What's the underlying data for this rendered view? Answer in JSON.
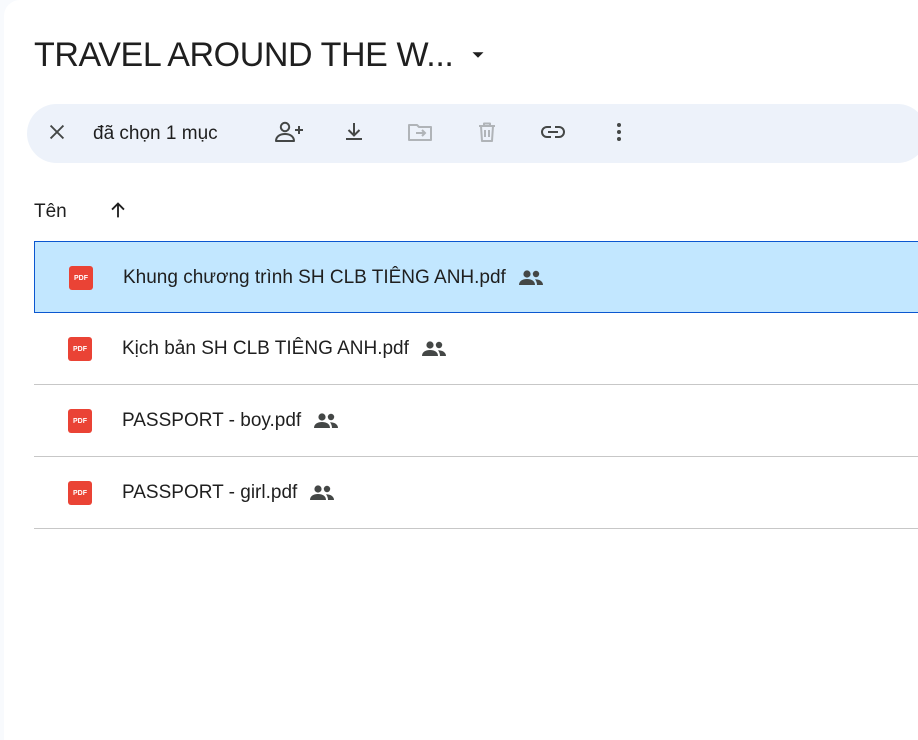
{
  "folder": {
    "title": "TRAVEL AROUND THE W...",
    "caret_icon": "arrow-drop-down-icon"
  },
  "selection_bar": {
    "count_label": "đã chọn 1 mục",
    "actions": [
      {
        "name": "clear-selection",
        "icon": "close-icon"
      },
      {
        "name": "share",
        "icon": "person-add-icon"
      },
      {
        "name": "download",
        "icon": "download-icon"
      },
      {
        "name": "move",
        "icon": "move-to-folder-icon"
      },
      {
        "name": "delete",
        "icon": "trash-icon"
      },
      {
        "name": "copy-link",
        "icon": "link-icon"
      },
      {
        "name": "more-actions",
        "icon": "more-vert-icon"
      }
    ]
  },
  "list_header": {
    "name_column": "Tên",
    "sort_icon": "arrow-up-icon"
  },
  "files": [
    {
      "name": "Khung chương trình SH CLB TIÊNG ANH.pdf",
      "type": "PDF",
      "shared": true,
      "selected": true
    },
    {
      "name": "Kịch bản SH CLB TIÊNG ANH.pdf",
      "type": "PDF",
      "shared": true,
      "selected": false
    },
    {
      "name": "PASSPORT - boy.pdf",
      "type": "PDF",
      "shared": true,
      "selected": false
    },
    {
      "name": "PASSPORT - girl.pdf",
      "type": "PDF",
      "shared": true,
      "selected": false
    }
  ],
  "colors": {
    "selected_row": "#c2e7ff",
    "selected_border": "#0b57d0",
    "toolbar_bg": "#edf2fa",
    "pdf_red": "#ea4335",
    "icon_gray": "#444746"
  }
}
